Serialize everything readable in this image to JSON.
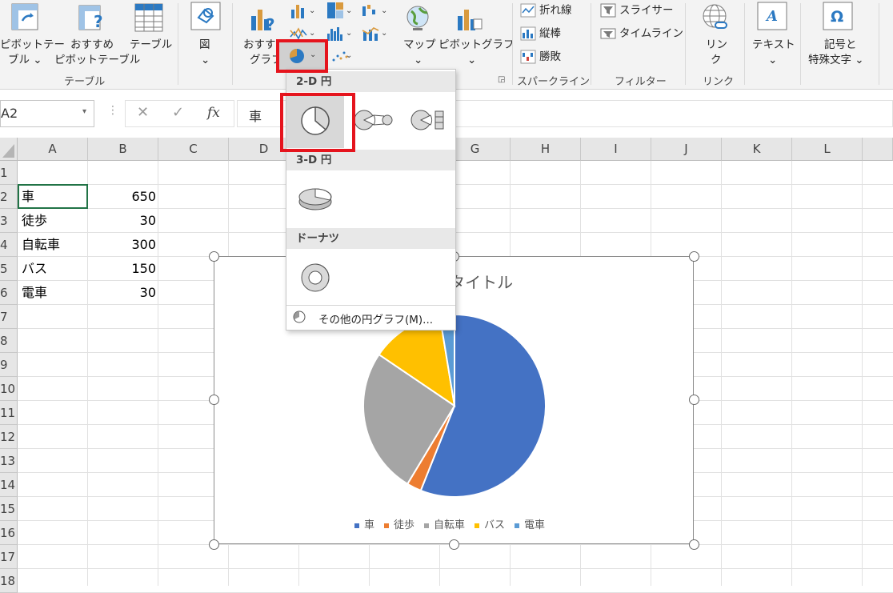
{
  "ribbon": {
    "table_group": {
      "pivot_table": [
        "ピボットテー",
        "ブル ⌄"
      ],
      "recommended_pivot": [
        "おすすめ",
        "ピボットテーブル"
      ],
      "table": "テーブル",
      "group_label": "テーブル"
    },
    "illustrations": {
      "label": "図",
      "caret": "⌄"
    },
    "charts": {
      "recommended": [
        "おすすめ",
        "グラフ"
      ],
      "map": "マップ",
      "pivot_chart": "ピボットグラフ"
    },
    "sparklines": {
      "line": "折れ線",
      "column": "縦棒",
      "win_loss": "勝敗",
      "group_label": "スパークライン"
    },
    "filters": {
      "slicer": "スライサー",
      "timeline": "タイムライン",
      "group_label": "フィルター"
    },
    "links": {
      "link": [
        "リン",
        "ク"
      ],
      "group_label": "リンク"
    },
    "text": {
      "label": "テキスト",
      "caret": "⌄"
    },
    "symbols": {
      "label": [
        "記号と",
        "特殊文字 ⌄"
      ]
    }
  },
  "formula_bar": {
    "name_box": "A2",
    "fx_label": "fx",
    "formula_value": "車"
  },
  "columns": [
    "A",
    "B",
    "C",
    "D",
    "E",
    "F",
    "G",
    "H",
    "I",
    "J",
    "K",
    "L"
  ],
  "rows": [
    "1",
    "2",
    "3",
    "4",
    "5",
    "6",
    "7",
    "8",
    "9",
    "10",
    "11",
    "12",
    "13",
    "14",
    "15",
    "16",
    "17",
    "18"
  ],
  "sheet_data": [
    {
      "label": "車",
      "value": "650"
    },
    {
      "label": "徒歩",
      "value": "30"
    },
    {
      "label": "自転車",
      "value": "300"
    },
    {
      "label": "バス",
      "value": "150"
    },
    {
      "label": "電車",
      "value": "30"
    }
  ],
  "chart_data": {
    "type": "pie",
    "title": "グラフ タイトル",
    "categories": [
      "車",
      "徒歩",
      "自転車",
      "バス",
      "電車"
    ],
    "values": [
      650,
      30,
      300,
      150,
      30
    ],
    "colors": [
      "#4472c4",
      "#ed7d31",
      "#a5a5a5",
      "#ffc000",
      "#5b9bd5"
    ],
    "legend_position": "bottom"
  },
  "dropdown": {
    "section_2d": "2-D 円",
    "section_3d": "3-D 円",
    "section_donut": "ドーナツ",
    "more_link": "その他の円グラフ(M)..."
  },
  "colors": {
    "highlight_red": "#e5141d",
    "ribbon_bg": "#f3f3f3"
  }
}
